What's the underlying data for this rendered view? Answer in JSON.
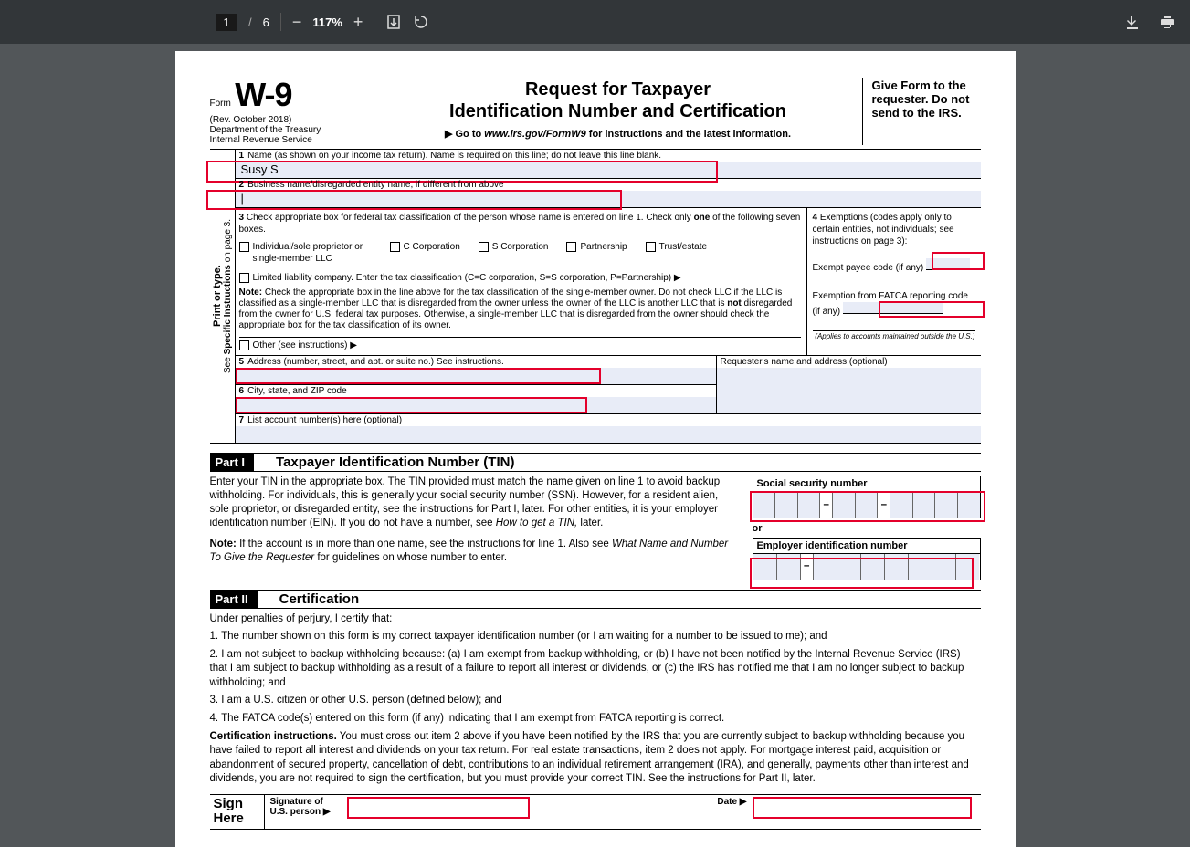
{
  "toolbar": {
    "page_current": "1",
    "page_sep": "/",
    "page_total": "6",
    "zoom": "117%"
  },
  "form": {
    "form_label": "Form",
    "form_number": "W-9",
    "rev": "(Rev. October 2018)",
    "dept": "Department of the Treasury",
    "irs": "Internal Revenue Service",
    "title_line1": "Request for Taxpayer",
    "title_line2": "Identification Number and Certification",
    "goto_prefix": "▶ Go to ",
    "goto_url": "www.irs.gov/FormW9",
    "goto_suffix": " for instructions and the latest information.",
    "give_form": "Give Form to the requester. Do not send to the IRS.",
    "vlabel_main": "Print or type.",
    "vlabel_sub": "See Specific Instructions on page 3.",
    "line1_label": "Name (as shown on your income tax return). Name is required on this line; do not leave this line blank.",
    "line1_value": "Susy S",
    "line2_label": "Business name/disregarded entity name, if different from above",
    "line2_value": "|",
    "line3_prefix": "Check appropriate box for federal tax classification of the person whose name is entered on line 1. Check only ",
    "line3_bold": "one",
    "line3_suffix": " of the following seven boxes.",
    "cb_individual": "Individual/sole proprietor or single-member LLC",
    "cb_ccorp": "C Corporation",
    "cb_scorp": "S Corporation",
    "cb_partnership": "Partnership",
    "cb_trust": "Trust/estate",
    "cb_llc": "Limited liability company. Enter the tax classification (C=C corporation, S=S corporation, P=Partnership) ▶",
    "llc_note_bold": "Note:",
    "llc_note": " Check the appropriate box in the line above for the tax classification of the single-member owner. Do not check LLC if the LLC is classified as a single-member LLC that is disregarded from the owner unless the owner of the LLC is another LLC that is ",
    "llc_note_bold2": "not",
    "llc_note2": " disregarded from the owner for U.S. federal tax purposes. Otherwise, a single-member LLC that is disregarded from the owner should check the appropriate box for the tax classification of its owner.",
    "cb_other": "Other (see instructions) ▶",
    "line4_text": "Exemptions (codes apply only to certain entities, not individuals; see instructions on page 3):",
    "exempt_payee": "Exempt payee code (if any)",
    "exempt_fatca": "Exemption from FATCA reporting code (if any)",
    "applies_note": "(Applies to accounts maintained outside the U.S.)",
    "line5_label": "Address (number, street, and apt. or suite no.) See instructions.",
    "requester_label": "Requester's name and address (optional)",
    "line6_label": "City, state, and ZIP code",
    "line7_label": "List account number(s) here (optional)"
  },
  "part1": {
    "tag": "Part I",
    "title": "Taxpayer Identification Number (TIN)",
    "para1": "Enter your TIN in the appropriate box. The TIN provided must match the name given on line 1 to avoid backup withholding. For individuals, this is generally your social security number (SSN). However, for a resident alien, sole proprietor, or disregarded entity, see the instructions for Part I, later. For other entities, it is your employer identification number (EIN). If you do not have a number, see ",
    "para1_italic": "How to get a TIN,",
    "para1_suffix": " later.",
    "note_bold": "Note:",
    "note_text": " If the account is in more than one name, see the instructions for line 1. Also see ",
    "note_italic": "What Name and Number To Give the Requester",
    "note_suffix": " for guidelines on whose number to enter.",
    "ssn_label": "Social security number",
    "or": "or",
    "ein_label": "Employer identification number"
  },
  "part2": {
    "tag": "Part II",
    "title": "Certification",
    "intro": "Under penalties of perjury, I certify that:",
    "item1": "1. The number shown on this form is my correct taxpayer identification number (or I am waiting for a number to be issued to me); and",
    "item2": "2. I am not subject to backup withholding because: (a) I am exempt from backup withholding, or (b) I have not been notified by the Internal Revenue Service (IRS) that I am subject to backup withholding as a result of a failure to report all interest or dividends, or (c) the IRS has notified me that I am no longer subject to backup withholding; and",
    "item3": "3. I am a U.S. citizen or other U.S. person (defined below); and",
    "item4": "4. The FATCA code(s) entered on this form (if any) indicating that I am exempt from FATCA reporting is correct.",
    "cert_bold": "Certification instructions.",
    "cert_text": " You must cross out item 2 above if you have been notified by the IRS that you are currently subject to backup withholding because you have failed to report all interest and dividends on your tax return. For real estate transactions, item 2 does not apply. For mortgage interest paid, acquisition or abandonment of secured property, cancellation of debt, contributions to an individual retirement arrangement (IRA), and generally, payments other than interest and dividends, you are not required to sign the certification, but you must provide your correct TIN. See the instructions for Part II, later.",
    "sign_here": "Sign Here",
    "signature_of": "Signature of U.S. person ▶",
    "date": "Date ▶"
  }
}
